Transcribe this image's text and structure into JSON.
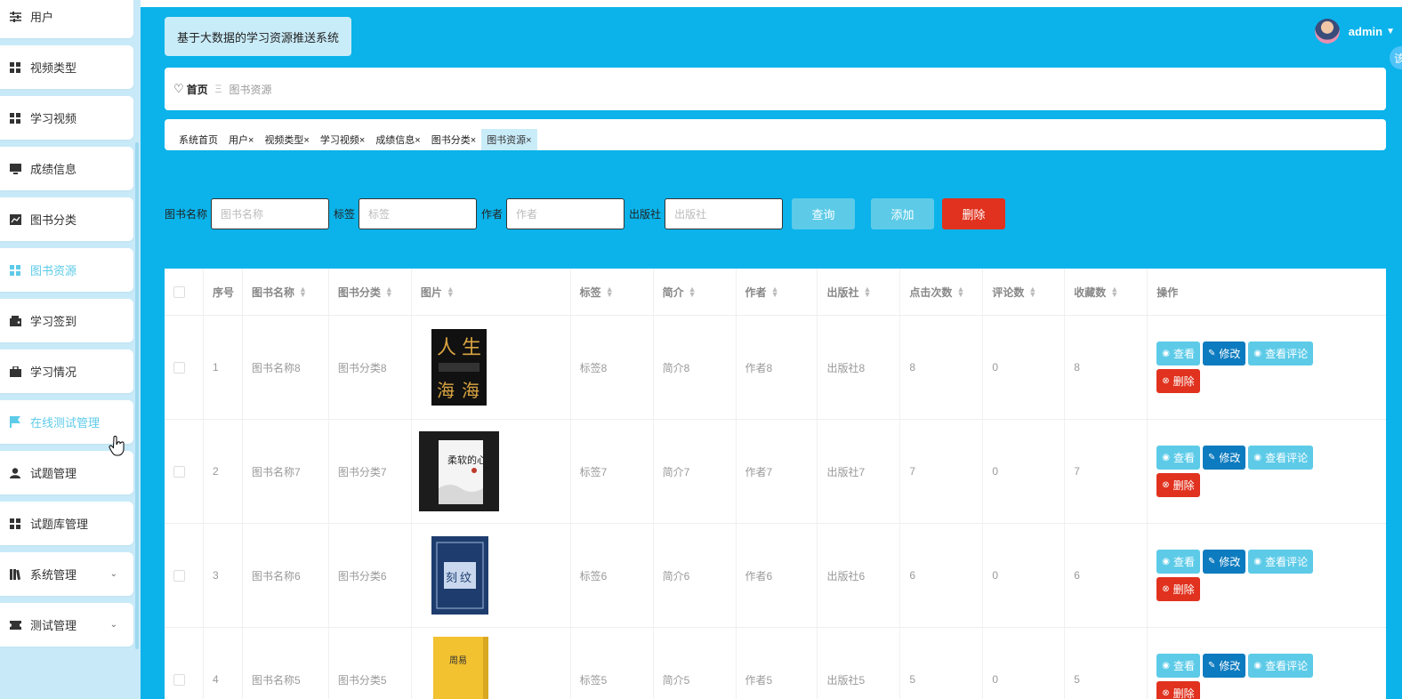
{
  "sidebar": {
    "items": [
      {
        "label": "用户",
        "icon": "sliders-icon"
      },
      {
        "label": "视频类型",
        "icon": "grid-icon"
      },
      {
        "label": "学习视频",
        "icon": "grid-icon"
      },
      {
        "label": "成绩信息",
        "icon": "monitor-icon"
      },
      {
        "label": "图书分类",
        "icon": "chart-icon"
      },
      {
        "label": "图书资源",
        "icon": "grid-icon",
        "active": true
      },
      {
        "label": "学习签到",
        "icon": "wallet-icon"
      },
      {
        "label": "学习情况",
        "icon": "briefcase-icon"
      },
      {
        "label": "在线测试管理",
        "icon": "flag-icon",
        "active": true
      },
      {
        "label": "试题管理",
        "icon": "user-icon"
      },
      {
        "label": "试题库管理",
        "icon": "grid-icon"
      },
      {
        "label": "系统管理",
        "icon": "book-icon"
      },
      {
        "label": "测试管理",
        "icon": "ticket-icon"
      }
    ]
  },
  "header": {
    "title": "基于大数据的学习资源推送系统",
    "user": "admin",
    "float_tab": "该"
  },
  "breadcrumb": {
    "home": "首页",
    "current": "图书资源"
  },
  "tags": [
    "系统首页",
    "用户×",
    "视频类型×",
    "学习视频×",
    "成绩信息×",
    "图书分类×",
    "图书资源×"
  ],
  "search": {
    "name_label": "图书名称",
    "name_placeholder": "图书名称",
    "tag_label": "标签",
    "tag_placeholder": "标签",
    "author_label": "作者",
    "author_placeholder": "作者",
    "publisher_label": "出版社",
    "publisher_placeholder": "出版社",
    "query": "查询",
    "add": "添加",
    "delete": "删除"
  },
  "table": {
    "headers": [
      "序号",
      "图书名称",
      "图书分类",
      "图片",
      "标签",
      "简介",
      "作者",
      "出版社",
      "点击次数",
      "评论数",
      "收藏数",
      "操作"
    ],
    "rows": [
      {
        "no": "1",
        "name": "图书名称8",
        "category": "图书分类8",
        "tag": "标签8",
        "intro": "简介8",
        "author": "作者8",
        "publisher": "出版社8",
        "clicks": "8",
        "comments": "0",
        "favorites": "8",
        "cover": "book-cover-black"
      },
      {
        "no": "2",
        "name": "图书名称7",
        "category": "图书分类7",
        "tag": "标签7",
        "intro": "简介7",
        "author": "作者7",
        "publisher": "出版社7",
        "clicks": "7",
        "comments": "0",
        "favorites": "7",
        "cover": "book-cover-white"
      },
      {
        "no": "3",
        "name": "图书名称6",
        "category": "图书分类6",
        "tag": "标签6",
        "intro": "简介6",
        "author": "作者6",
        "publisher": "出版社6",
        "clicks": "6",
        "comments": "0",
        "favorites": "6",
        "cover": "book-cover-blue"
      },
      {
        "no": "4",
        "name": "图书名称5",
        "category": "图书分类5",
        "tag": "标签5",
        "intro": "简介5",
        "author": "作者5",
        "publisher": "出版社5",
        "clicks": "5",
        "comments": "0",
        "favorites": "5",
        "cover": "book-cover-yellow"
      }
    ],
    "actions": {
      "view": "查看",
      "edit": "修改",
      "comments": "查看评论",
      "delete": "删除"
    }
  },
  "colors": {
    "main_bg": "#0bb3ea",
    "accent": "#5dcbe8",
    "edit": "#0d7bbf",
    "danger": "#e0321e"
  }
}
